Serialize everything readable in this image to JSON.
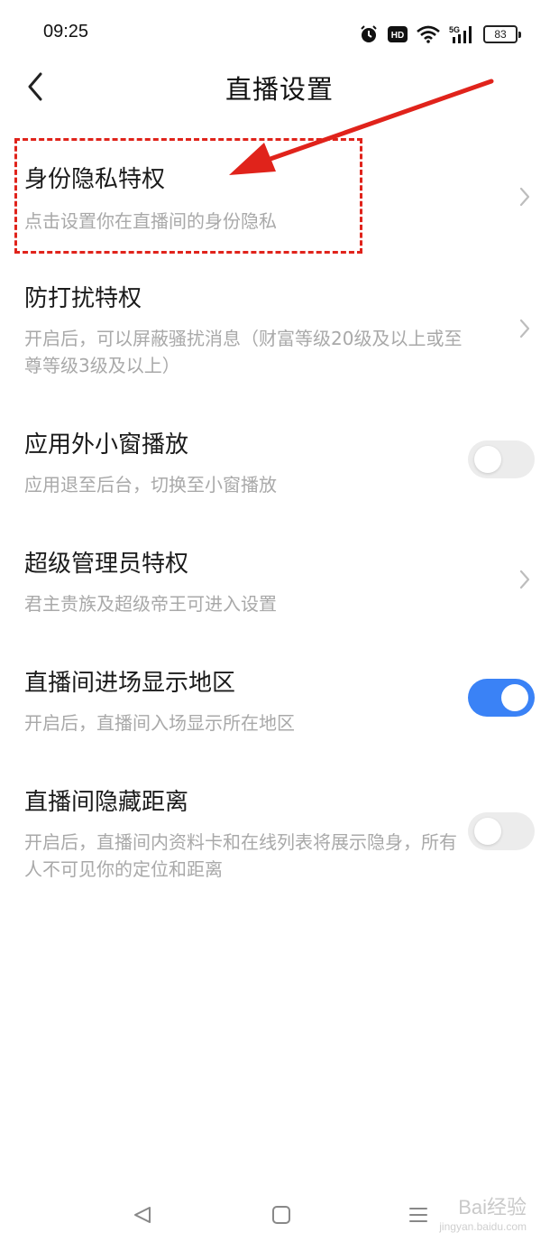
{
  "status_bar": {
    "time": "09:25",
    "battery": "83",
    "network": "5G",
    "hd": "HD"
  },
  "nav": {
    "title": "直播设置"
  },
  "settings": [
    {
      "title": "身份隐私特权",
      "desc": "点击设置你在直播间的身份隐私",
      "control": "chevron"
    },
    {
      "title": "防打扰特权",
      "desc": "开启后，可以屏蔽骚扰消息（财富等级20级及以上或至尊等级3级及以上）",
      "control": "chevron"
    },
    {
      "title": "应用外小窗播放",
      "desc": "应用退至后台，切换至小窗播放",
      "control": "toggle",
      "on": false
    },
    {
      "title": "超级管理员特权",
      "desc": "君主贵族及超级帝王可进入设置",
      "control": "chevron"
    },
    {
      "title": "直播间进场显示地区",
      "desc": "开启后，直播间入场显示所在地区",
      "control": "toggle",
      "on": true
    },
    {
      "title": "直播间隐藏距离",
      "desc": "开启后，直播间内资料卡和在线列表将展示隐身，所有人不可见你的定位和距离",
      "control": "toggle",
      "on": false
    }
  ],
  "colors": {
    "accent": "#3a82f6",
    "annotation": "#e0231b",
    "muted_text": "#a9a9a9"
  },
  "watermark": {
    "brand": "Bai经验",
    "url": "jingyan.baidu.com"
  }
}
